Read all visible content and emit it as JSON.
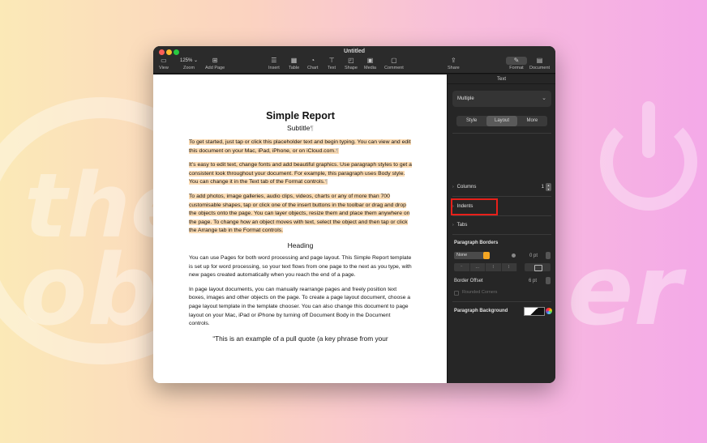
{
  "window": {
    "title": "Untitled"
  },
  "toolbar": {
    "view": "View",
    "zoom_value": "125%",
    "zoom": "Zoom",
    "add_page": "Add Page",
    "insert": "Insert",
    "table": "Table",
    "chart": "Chart",
    "text": "Text",
    "shape": "Shape",
    "media": "Media",
    "comment": "Comment",
    "share": "Share",
    "format": "Format",
    "document": "Document"
  },
  "document": {
    "title": "Simple Report",
    "subtitle": "Subtitle",
    "para1": "To get started, just tap or click this placeholder text and begin typing. You can view and edit this document on your Mac, iPad, iPhone, or on iCloud.com.",
    "para2": "It’s easy to edit text, change fonts and add beautiful graphics. Use paragraph styles to get a consistent look throughout your document. For example, this paragraph uses Body style. You can change it in the Text tab of the Format controls.",
    "para3": "To add photos, image galleries, audio clips, videos, charts or any of more than 700 customisable shapes, tap or click one of the insert buttons in the toolbar or drag and drop the objects onto the page. You can layer objects, resize them and place them anywhere on the page. To change how an object moves with text, select the object and then tap or click the Arrange tab in the Format controls.",
    "heading": "Heading",
    "para4": "You can use Pages for both word processing and page layout. This Simple Report template is set up for word processing, so your text flows from one page to the next as you type, with new pages created automatically when you reach the end of a page.",
    "para5": "In page layout documents, you can manually rearrange pages and freely position text boxes, images and other objects on the page. To create a page layout document, choose a page layout template in the template chooser. You can also change this document to page layout on your Mac, iPad or iPhone by turning off Document Body in the Document controls.",
    "quote": "“This is an example of a pull quote (a key phrase from your"
  },
  "inspector": {
    "header": "Text",
    "style_select": "Multiple",
    "tabs": [
      "Style",
      "Layout",
      "More"
    ],
    "columns_label": "Columns",
    "columns_value": "1",
    "indents_label": "Indents",
    "tabs_label": "Tabs",
    "paragraph_borders": "Paragraph Borders",
    "border_style": "None",
    "border_width": "0 pt",
    "border_offset_label": "Border Offset",
    "border_offset_value": "6 pt",
    "rounded_corners": "Rounded Corners",
    "paragraph_background": "Paragraph Background"
  },
  "colors": {
    "highlight": "#fcdcb4",
    "annotation": "#e8201a"
  }
}
